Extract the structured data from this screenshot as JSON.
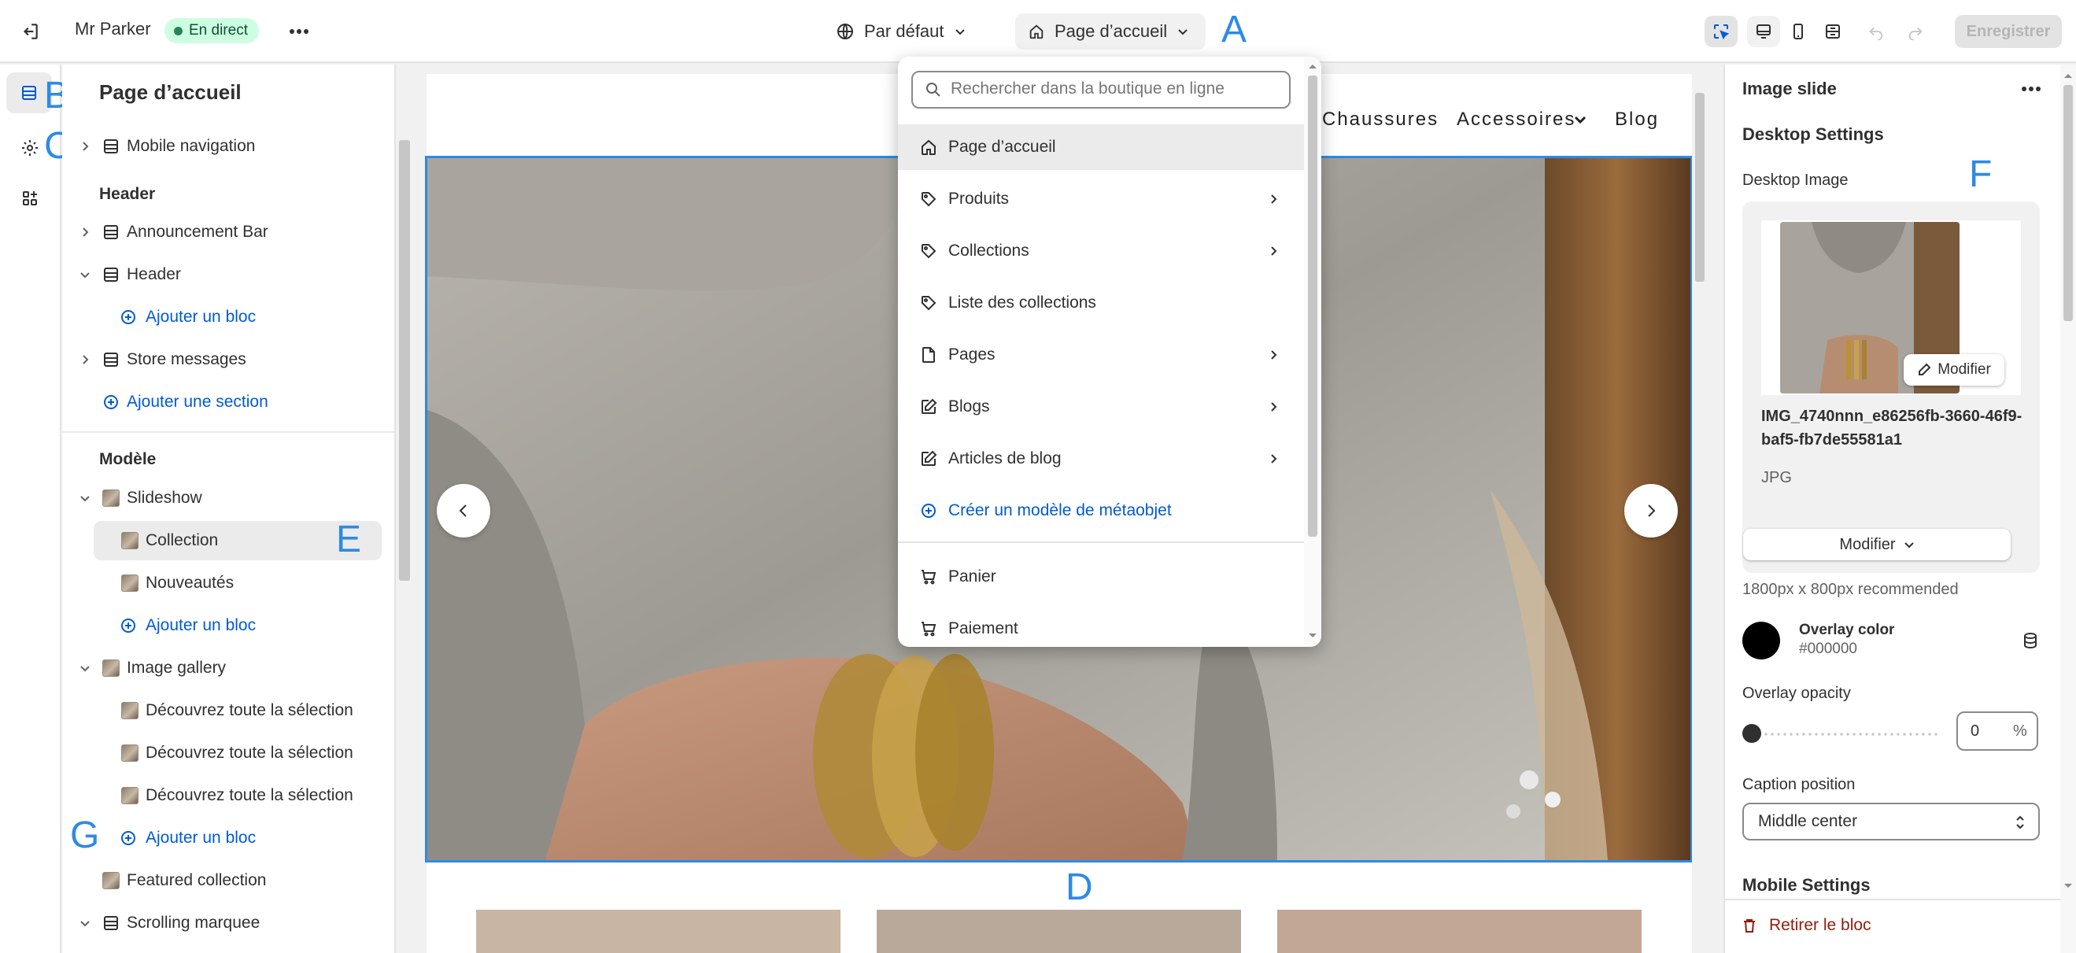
{
  "topbar": {
    "store_name": "Mr Parker",
    "status_badge": "En direct",
    "theme_selector": "Par défaut",
    "page_selector": "Page d’accueil",
    "save_button": "Enregistrer"
  },
  "annotations": {
    "a": "A",
    "b": "B",
    "c": "C",
    "d": "D",
    "e": "E",
    "f": "F",
    "g": "G"
  },
  "left_panel": {
    "title": "Page d’accueil",
    "mobile_nav": "Mobile navigation",
    "header_group": "Header",
    "announcement_bar": "Announcement Bar",
    "header": "Header",
    "add_block_1": "Ajouter un bloc",
    "store_messages": "Store messages",
    "add_section": "Ajouter une section",
    "template_group": "Modèle",
    "slideshow": "Slideshow",
    "collection": "Collection",
    "nouveautes": "Nouveautés",
    "add_block_2": "Ajouter un bloc",
    "image_gallery": "Image gallery",
    "gallery_item_1": "Découvrez toute la sélection",
    "gallery_item_2": "Découvrez toute la sélection",
    "gallery_item_3": "Découvrez toute la sélection",
    "add_block_3": "Ajouter un bloc",
    "featured_collection": "Featured collection",
    "scrolling_marquee": "Scrolling marquee"
  },
  "preview": {
    "nav": [
      "Chaussures",
      "Accessoires",
      "Blog"
    ]
  },
  "dropdown": {
    "search_placeholder": "Rechercher dans la boutique en ligne",
    "items": [
      {
        "label": "Page d’accueil",
        "icon": "home-icon"
      },
      {
        "label": "Produits",
        "icon": "tag-icon"
      },
      {
        "label": "Collections",
        "icon": "tag-icon"
      },
      {
        "label": "Liste des collections",
        "icon": "tag-icon"
      },
      {
        "label": "Pages",
        "icon": "page-icon"
      },
      {
        "label": "Blogs",
        "icon": "compose-icon"
      },
      {
        "label": "Articles de blog",
        "icon": "compose-icon"
      },
      {
        "label": "Créer un modèle de métaobjet",
        "icon": "plus-circle-icon"
      },
      {
        "label": "Panier",
        "icon": "cart-icon"
      },
      {
        "label": "Paiement",
        "icon": "cart-icon"
      }
    ]
  },
  "right_panel": {
    "title": "Image slide",
    "desktop_settings": "Desktop Settings",
    "desktop_image": "Desktop Image",
    "modify_pill": "Modifier",
    "file_name": "IMG_4740nnn_e86256fb-3660-46f9-baf5-fb7de55581a1",
    "file_type": "JPG",
    "modify_button": "Modifier",
    "recommended": "1800px x 800px recommended",
    "overlay_color_label": "Overlay color",
    "overlay_color_value": "#000000",
    "overlay_opacity_label": "Overlay opacity",
    "overlay_opacity_value": "0",
    "overlay_opacity_unit": "%",
    "caption_position_label": "Caption position",
    "caption_position_value": "Middle center",
    "mobile_settings": "Mobile Settings",
    "remove_block": "Retirer le bloc"
  },
  "colors": {
    "accent": "#005bd3",
    "annotation": "#2e8ae6",
    "live_badge_bg": "#cdfee1",
    "danger": "#8e1f0b"
  }
}
